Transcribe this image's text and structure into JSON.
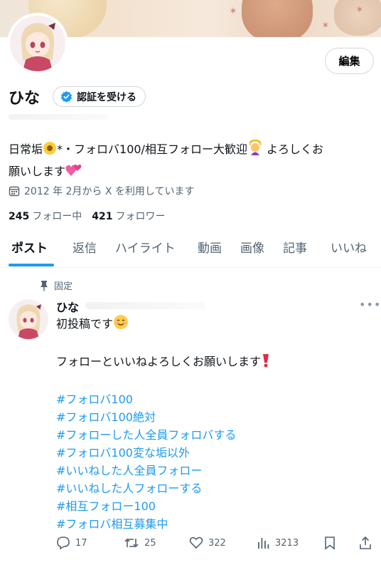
{
  "profile": {
    "name": "ひな",
    "verify_label": "認証を受ける",
    "edit_label": "編集",
    "bio_part1": "日常垢",
    "bio_part2": "*・フォロバ100/相互フォロー大歓迎",
    "bio_part3": " よろしくお",
    "bio_part4": "願いします",
    "joined": "2012 年 2月から X を利用しています",
    "following_count": "245",
    "following_label": "フォロー中",
    "followers_count": "421",
    "followers_label": "フォロワー"
  },
  "tabs": [
    "ポスト",
    "返信",
    "ハイライト",
    "動画",
    "画像",
    "記事",
    "いいね"
  ],
  "post": {
    "pinned_label": "固定",
    "author": "ひな",
    "line1": "初投稿です",
    "line2": "フォローといいねよろしくお願いします",
    "hashtags": [
      "#フォロバ100",
      "#フォロバ100絶対",
      "#フォローした人全員フォロバする",
      "#フォロバ100変な垢以外",
      "#いいねした人全員フォロー",
      "#いいねした人フォローする",
      "#相互フォロー100",
      "#フォロバ相互募集中"
    ],
    "replies": "17",
    "reposts": "25",
    "likes": "322",
    "views": "3213"
  },
  "colors": {
    "accent": "#1d9bf0",
    "secondary_text": "#536471"
  }
}
